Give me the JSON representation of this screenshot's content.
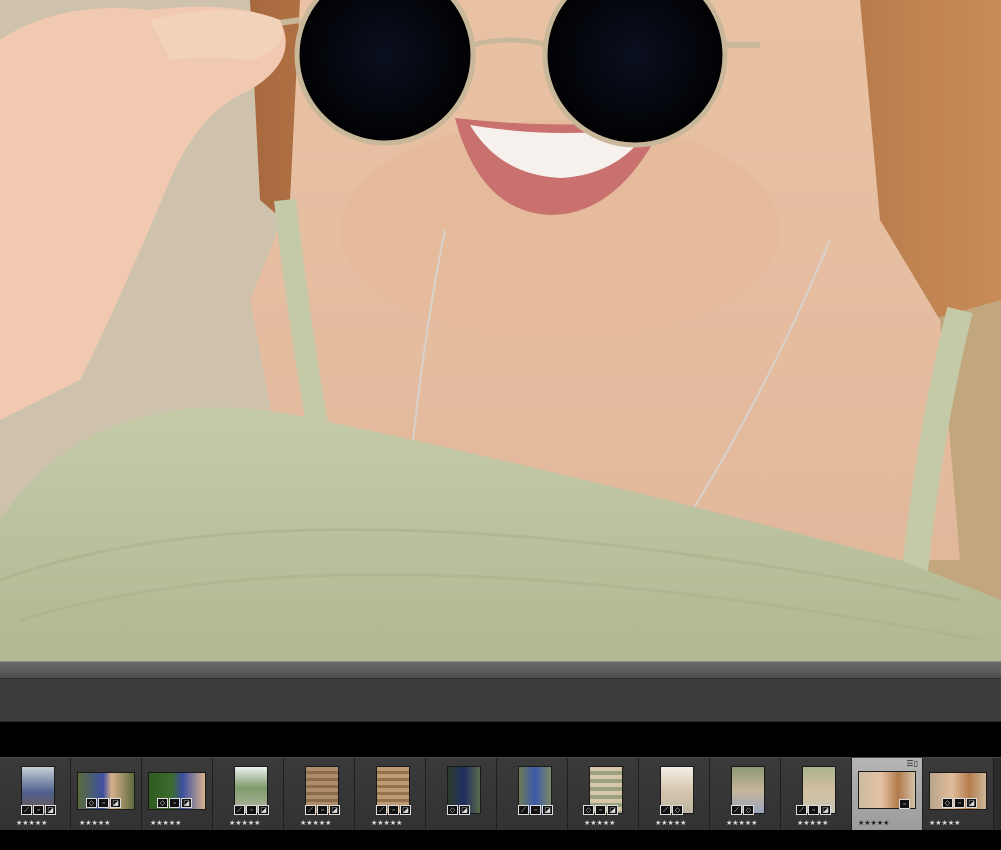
{
  "filmstrip": {
    "stars": "★★★★★",
    "selected_index": 13,
    "thumbnail_count": 14
  },
  "colors": {
    "panel": "#3d3d3d",
    "filmstrip_bg": "#2b2b2b",
    "selected_cell": "#b5b5b5"
  }
}
